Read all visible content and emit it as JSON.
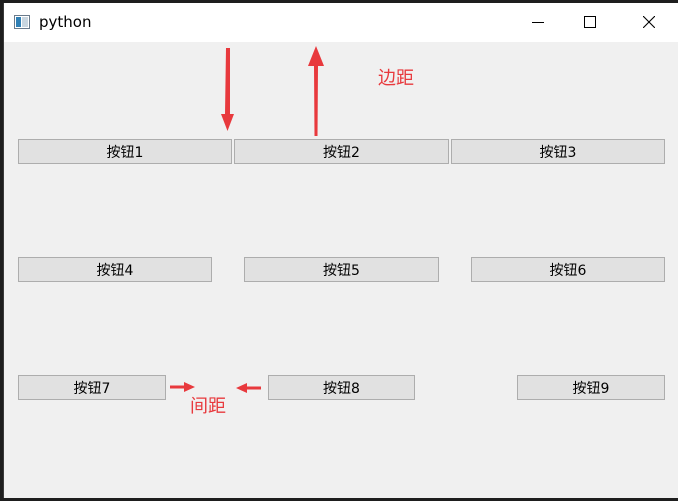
{
  "window": {
    "title": "python",
    "icon": "qt-window-icon",
    "controls": {
      "minimize": "minimize-icon",
      "maximize": "maximize-icon",
      "close": "close-icon"
    }
  },
  "buttons": [
    {
      "label": "按钮1"
    },
    {
      "label": "按钮2"
    },
    {
      "label": "按钮3"
    },
    {
      "label": "按钮4"
    },
    {
      "label": "按钮5"
    },
    {
      "label": "按钮6"
    },
    {
      "label": "按钮7"
    },
    {
      "label": "按钮8"
    },
    {
      "label": "按钮9"
    }
  ],
  "annotations": {
    "margin_label": "边距",
    "spacing_label": "间距",
    "color": "#e8393d"
  }
}
